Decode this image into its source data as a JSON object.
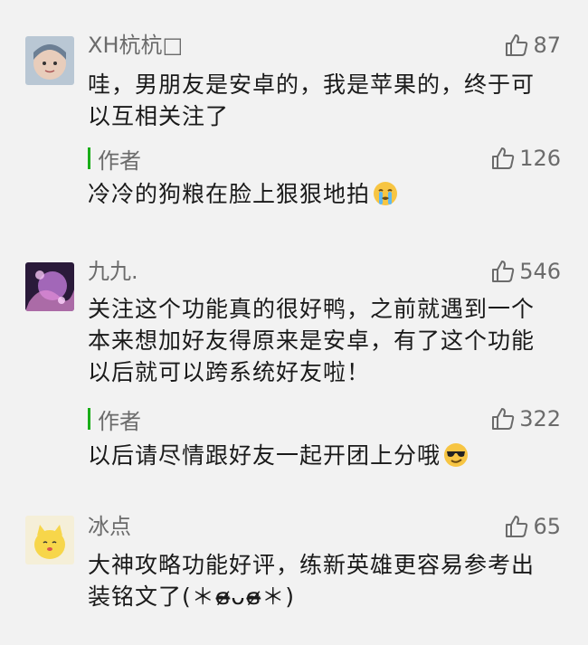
{
  "comments": [
    {
      "username": "XH杭杭□",
      "likes": "87",
      "text": "哇，男朋友是安卓的，我是苹果的，终于可以互相关注了",
      "reply": {
        "author": "作者",
        "likes": "126",
        "text": "冷冷的狗粮在脸上狠狠地拍",
        "emoji": "crying-face-emoji"
      }
    },
    {
      "username": "九九.",
      "likes": "546",
      "text": "关注这个功能真的很好鸭，之前就遇到一个本来想加好友得原来是安卓，有了这个功能以后就可以跨系统好友啦！",
      "reply": {
        "author": "作者",
        "likes": "322",
        "text": "以后请尽情跟好友一起开团上分哦",
        "emoji": "sunglasses-face-emoji"
      }
    },
    {
      "username": "冰点",
      "likes": "65",
      "text": "大神攻略功能好评，练新英雄更容易参考出装铭文了(＊ɞ̴̶̷ᴗɞ̴̶̷＊)"
    }
  ],
  "colors": {
    "accent": "#1aad19",
    "meta_text": "#6b6b6b",
    "background": "#f2f2f2"
  }
}
